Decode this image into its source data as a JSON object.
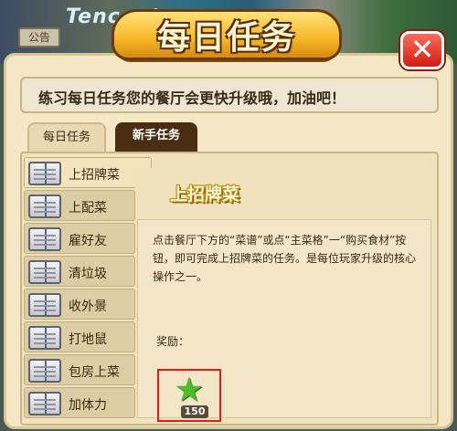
{
  "background": {
    "sign_text": "公告",
    "bg_text": "Tencent"
  },
  "dialog": {
    "title": "每日任务",
    "close_symbol": "✕",
    "message": "练习每日任务您的餐厅会更快升级哦，加油吧！"
  },
  "tabs": [
    {
      "label": "每日任务"
    },
    {
      "label": "新手任务"
    }
  ],
  "tasks": [
    {
      "label": "上招牌菜"
    },
    {
      "label": "上配菜"
    },
    {
      "label": "雇好友"
    },
    {
      "label": "清垃圾"
    },
    {
      "label": "收外景"
    },
    {
      "label": "打地鼠"
    },
    {
      "label": "包房上菜"
    },
    {
      "label": "加体力"
    }
  ],
  "detail": {
    "title": "上招牌菜",
    "description": "点击餐厅下方的“菜谱”或点“主菜格”一“购买食材”按钮，即可完成上招牌菜的任务。是每位玩家升级的核心操作之一。",
    "reward_label": "奖励：",
    "reward_icon": "star-icon",
    "reward_count": "150"
  },
  "colors": {
    "panel": "#f4e7c6",
    "banner": "#f5b725",
    "close": "#d21d12",
    "tab_active": "#4a2e12",
    "reward_highlight": "#e31b1b"
  }
}
